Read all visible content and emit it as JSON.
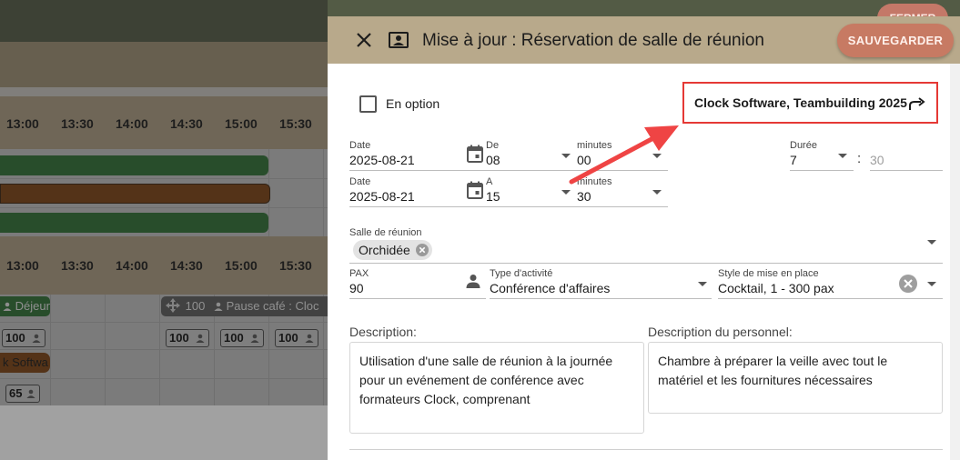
{
  "background": {
    "close_button_label": "FERMER",
    "hours_row_1": [
      "13:00",
      "13:30",
      "14:00",
      "14:30",
      "15:00",
      "15:30"
    ],
    "hours_row_2": [
      "13:00",
      "13:30",
      "14:00",
      "14:30",
      "15:00",
      "15:30"
    ],
    "tags": {
      "lunch": "Déjeun",
      "pause_count": "100",
      "pause": "Pause café : Cloc",
      "software": "k Softwa"
    },
    "pax_badges": [
      "100",
      "100",
      "100",
      "100",
      "65"
    ]
  },
  "dialog": {
    "title": "Mise à jour : Réservation de salle de réunion",
    "save_label": "SAUVEGARDER",
    "option": {
      "label": "En option",
      "checked": false
    },
    "linked_event": "Clock Software, Teambuilding 2025",
    "start": {
      "date_label": "Date",
      "date_value": "2025-08-21",
      "hour_label": "De",
      "hour_value": "08",
      "minutes_label": "minutes",
      "minutes_value": "00"
    },
    "end": {
      "date_label": "Date",
      "date_value": "2025-08-21",
      "hour_label": "A",
      "hour_value": "15",
      "minutes_label": "minutes",
      "minutes_value": "30"
    },
    "duration": {
      "label": "Durée",
      "hours": "7",
      "separator": ":",
      "minutes": "30"
    },
    "room": {
      "label": "Salle de réunion",
      "value": "Orchidée"
    },
    "pax": {
      "label": "PAX",
      "value": "90"
    },
    "activity": {
      "label": "Type d'activité",
      "value": "Conférence d'affaires"
    },
    "setup": {
      "label": "Style de mise en place",
      "value": "Cocktail, 1 - 300 pax"
    },
    "description": {
      "label": "Description:",
      "value": "Utilisation d'une salle de réunion à la journée pour un evénement de conférence avec formateurs Clock, comprenant"
    },
    "staff_description": {
      "label": "Description du personnel:",
      "value": "Chambre à préparer la veille avec tout le matériel et les fournitures nécessaires"
    }
  },
  "colors": {
    "header_bg": "#b8a98b",
    "save_button": "#c77a63",
    "highlight_border": "#e53935",
    "annotation_arrow": "#ef4444"
  },
  "icons": {
    "close": "close-icon",
    "title": "contact-card-icon",
    "linked_event": "forward-arrow-icon",
    "calendar": "calendar-icon",
    "person": "person-icon",
    "chip_remove": "chip-remove-icon",
    "clear": "clear-circle-icon",
    "dropdown": "chevron-down-icon"
  }
}
